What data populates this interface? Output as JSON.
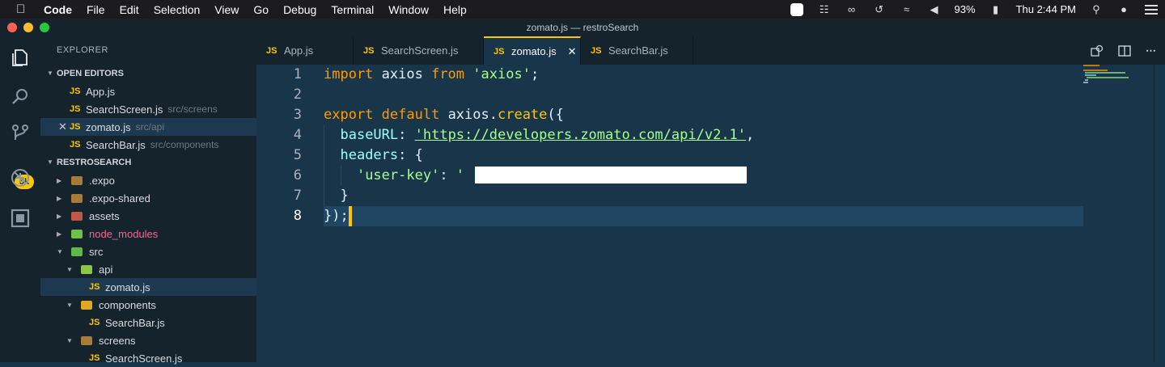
{
  "menubar": {
    "items": [
      "Code",
      "File",
      "Edit",
      "Selection",
      "View",
      "Go",
      "Debug",
      "Terminal",
      "Window",
      "Help"
    ],
    "battery": "93%",
    "clock": "Thu 2:44 PM"
  },
  "window": {
    "title": "zomato.js — restroSearch"
  },
  "activity": {
    "badge": "5k"
  },
  "sidebar": {
    "header": "EXPLORER",
    "open_editors": {
      "title": "OPEN EDITORS",
      "items": [
        {
          "name": "App.js",
          "path": ""
        },
        {
          "name": "SearchScreen.js",
          "path": "src/screens"
        },
        {
          "name": "zomato.js",
          "path": "src/api"
        },
        {
          "name": "SearchBar.js",
          "path": "src/components"
        }
      ]
    },
    "project": {
      "title": "RESTROSEARCH",
      "items": [
        ".expo",
        ".expo-shared",
        "assets",
        "node_modules",
        "src",
        "api",
        "zomato.js",
        "components",
        "SearchBar.js",
        "screens",
        "SearchScreen.js"
      ]
    },
    "js_label": "JS"
  },
  "tabs": [
    {
      "label": "App.js"
    },
    {
      "label": "SearchScreen.js"
    },
    {
      "label": "zomato.js"
    },
    {
      "label": "SearchBar.js"
    }
  ],
  "editor": {
    "line_numbers": [
      "1",
      "2",
      "3",
      "4",
      "5",
      "6",
      "7",
      "8"
    ],
    "lines": {
      "l1": {
        "kw1": "import",
        "id": " axios ",
        "kw2": "from",
        "sp": " ",
        "str": "'axios'",
        "end": ";"
      },
      "l3": {
        "kw1": "export",
        "sp1": " ",
        "kw2": "default",
        "id": " axios.",
        "fn": "create",
        "end": "({"
      },
      "l4": {
        "indent": "  ",
        "prop": "baseURL",
        "colon": ": ",
        "str": "'https://developers.zomato.com/api/v2.1'",
        "end": ","
      },
      "l5": {
        "indent": "  ",
        "prop": "headers",
        "end": ": {"
      },
      "l6": {
        "indent": "    ",
        "str": "'user-key'",
        "colon": ": ",
        "open": "'",
        "close": "'"
      },
      "l7": {
        "text": "  }"
      },
      "l8": {
        "text": "});"
      }
    }
  }
}
